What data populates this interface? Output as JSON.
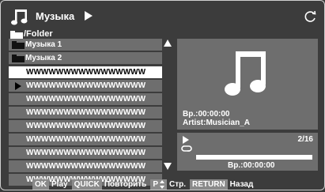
{
  "header": {
    "title": "Музыка",
    "icons": [
      "music-note-icon",
      "play-icon",
      "refresh-icon"
    ]
  },
  "path": {
    "folder_label": "/Folder"
  },
  "list": {
    "items": [
      {
        "type": "folder",
        "label": "Музыка 1"
      },
      {
        "type": "folder",
        "label": "Музыка 2"
      },
      {
        "type": "file",
        "label": "WWWWWWWWWWWWWWWW",
        "selected": true
      },
      {
        "type": "file",
        "label": "WWWWWWWWWWWWWWWW",
        "playing": true
      },
      {
        "type": "file",
        "label": "WWWWWWWWWWWWWWWW"
      },
      {
        "type": "file",
        "label": "WWWWWWWWWWWWWWWW"
      },
      {
        "type": "file",
        "label": "WWWWWWWWWWWWWWWW"
      },
      {
        "type": "file",
        "label": "WWWWWWWWWWWWWWWW"
      },
      {
        "type": "file",
        "label": "WWWWWWWWWWWWWWWW"
      },
      {
        "type": "file",
        "label": "WWWWWWWWWWWWWWWW"
      },
      {
        "type": "file",
        "label": "WWWWWWWWWWWWWWWW"
      }
    ]
  },
  "preview": {
    "time": "Вр.:00:00:00",
    "artist": "Artist:Musician_A"
  },
  "player": {
    "counter": "2/16",
    "time": "Вр.:00:00:00",
    "progress_percent": 100
  },
  "footer": {
    "ok_key": "OK",
    "ok_label": "Play",
    "quick_key": "QUICK",
    "quick_label": "Повторить",
    "p_key": "P",
    "p_label": "Стр.",
    "return_key": "RETURN",
    "return_label": "Назад"
  },
  "colors": {
    "background": "#3c3c3c",
    "row": "#6e6e6e",
    "selected_row": "#ffffff",
    "key_bg": "#8a8a8a"
  }
}
